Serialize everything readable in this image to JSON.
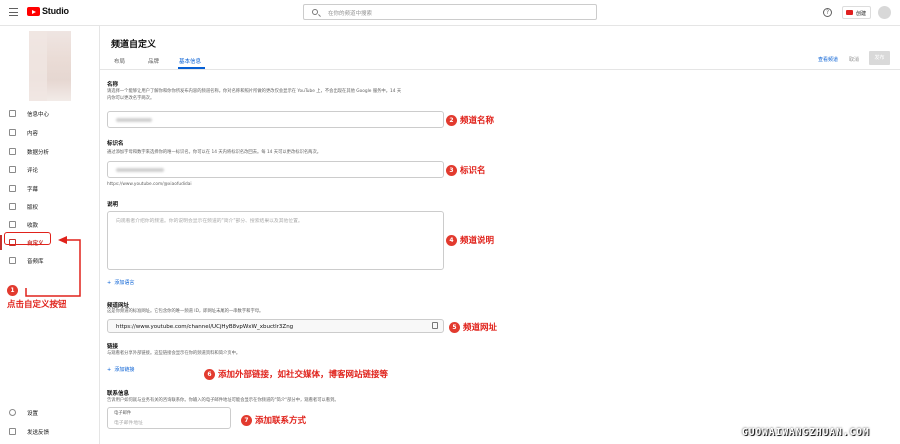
{
  "topbar": {
    "app_name": "Studio",
    "search_placeholder": "在你的频道中搜索",
    "help": "?",
    "create_label": "创建"
  },
  "sidebar": {
    "items": [
      {
        "label": "信息中心",
        "icon": "dashboard-icon"
      },
      {
        "label": "内容",
        "icon": "content-icon"
      },
      {
        "label": "数据分析",
        "icon": "analytics-icon"
      },
      {
        "label": "评论",
        "icon": "comments-icon"
      },
      {
        "label": "字幕",
        "icon": "subtitles-icon"
      },
      {
        "label": "版权",
        "icon": "copyright-icon"
      },
      {
        "label": "收款",
        "icon": "earn-icon"
      },
      {
        "label": "自定义",
        "icon": "customization-icon",
        "active": true
      },
      {
        "label": "音频库",
        "icon": "audio-library-icon"
      }
    ],
    "bottom": [
      {
        "label": "设置",
        "icon": "settings-icon"
      },
      {
        "label": "发送反馈",
        "icon": "feedback-icon"
      }
    ]
  },
  "page": {
    "title": "频道自定义",
    "tabs": [
      "布局",
      "品牌",
      "基本信息"
    ],
    "active_tab": 2,
    "view_channel": "查看频道",
    "cancel": "取消",
    "publish": "发布"
  },
  "sections": {
    "name": {
      "title": "名称",
      "desc1": "请选择一个能够让用户了解你和你你所发布内容的频道名称。你对名称和照片所做的更改仅会显示在 YouTube 上，不会出现在其他 Google 服务中。14 天",
      "desc2": "内你可以更改名字两次。"
    },
    "handle": {
      "title": "标识名",
      "desc": "通过添加字母和数字来选择你的唯一标识名。你可以在 14 天内将标识名改回去。每 14 天可以更改标识名两次。",
      "url_hint": "https://www.youtube.com/@xiaofudidai"
    },
    "description": {
      "title": "说明",
      "placeholder": "向观看者介绍你的频道。你的说明会显示在频道的\"简介\"部分、搜索结果以及其他位置。",
      "add_language": "添加语言"
    },
    "channel_url": {
      "title": "频道网址",
      "desc": "这是你频道的标准网址。它包含你的唯一频道 ID，即网址末尾的一串数字和字母。",
      "url": "https://www.youtube.com/channel/UCjHyB8vpWxW_xbuctlr3Zng"
    },
    "links": {
      "title": "链接",
      "desc": "与观看者分享外部链接。这些链接会显示在你的频道资料和简介页中。",
      "add_link": "添加链接"
    },
    "contact": {
      "title": "联系信息",
      "desc": "告诉用户如何就与业务有关的咨询联系你。你输入的电子邮件地址可能会显示在你频道的\"简介\"部分中，观看者可以看到。",
      "email_label": "电子邮件",
      "email_placeholder": "电子邮件地址"
    }
  },
  "annotations": [
    {
      "num": "1",
      "text": "点击自定义按钮"
    },
    {
      "num": "2",
      "text": "频道名称"
    },
    {
      "num": "3",
      "text": "标识名"
    },
    {
      "num": "4",
      "text": "频道说明"
    },
    {
      "num": "5",
      "text": "频道网址"
    },
    {
      "num": "6",
      "text": "添加外部链接，如社交媒体，博客网站链接等"
    },
    {
      "num": "7",
      "text": "添加联系方式"
    }
  ],
  "watermark": "GUOWAIWANGZHUAN.COM",
  "colors": {
    "accent": "#065fd4",
    "brand": "#ff0000",
    "annotation": "#e0221b",
    "active": "#c4302b"
  }
}
